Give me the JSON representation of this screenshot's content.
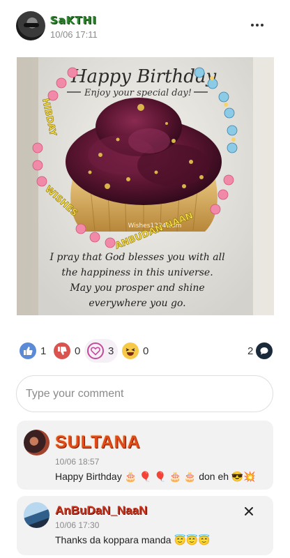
{
  "post": {
    "author": "SaKTHI",
    "time": "10/06 17:11",
    "more_icon": "more-options-icon",
    "image": {
      "title": "Happy Birthday",
      "subtitle": "Enjoy your special day!",
      "watermark": "Wishes1234.com",
      "arc_left": "HIBDAY",
      "arc_bottom_left": "WISHES",
      "arc_bottom_right": "ANBUDAN NAAN",
      "message_lines": [
        "I pray that God blesses you with all",
        "the happiness in this universe.",
        "May you prosper and shine",
        "everywhere you go."
      ]
    }
  },
  "reactions": [
    {
      "name": "like",
      "icon": "thumbs-up-icon",
      "count": "1",
      "color": "#5b8ad7"
    },
    {
      "name": "dislike",
      "icon": "thumbs-down-icon",
      "count": "0",
      "color": "#d9534f"
    },
    {
      "name": "love",
      "icon": "heart-icon",
      "count": "3",
      "color": "#c44b9a"
    },
    {
      "name": "laugh",
      "icon": "laughing-face-icon",
      "count": "0",
      "color": "#f7c948"
    }
  ],
  "comment_count": {
    "count": "2",
    "icon": "comment-bubble-icon"
  },
  "comment_input": {
    "placeholder": "Type your comment"
  },
  "comments": [
    {
      "author": "SULTANA",
      "time": "10/06 18:57",
      "text": "Happy Birthday 🎂 🎈 🎈 🎂 🎂 don eh 😎💥"
    },
    {
      "author": "AnBuDaN_NaaN",
      "time": "10/06 17:30",
      "text": "Thanks da koppara manda 😇😇😇",
      "close_icon": "close-icon"
    }
  ],
  "colors": {
    "accent_blue": "#5b8ad7",
    "cupcake_frosting": "#5a1530",
    "text_muted": "#8a8a8a"
  }
}
